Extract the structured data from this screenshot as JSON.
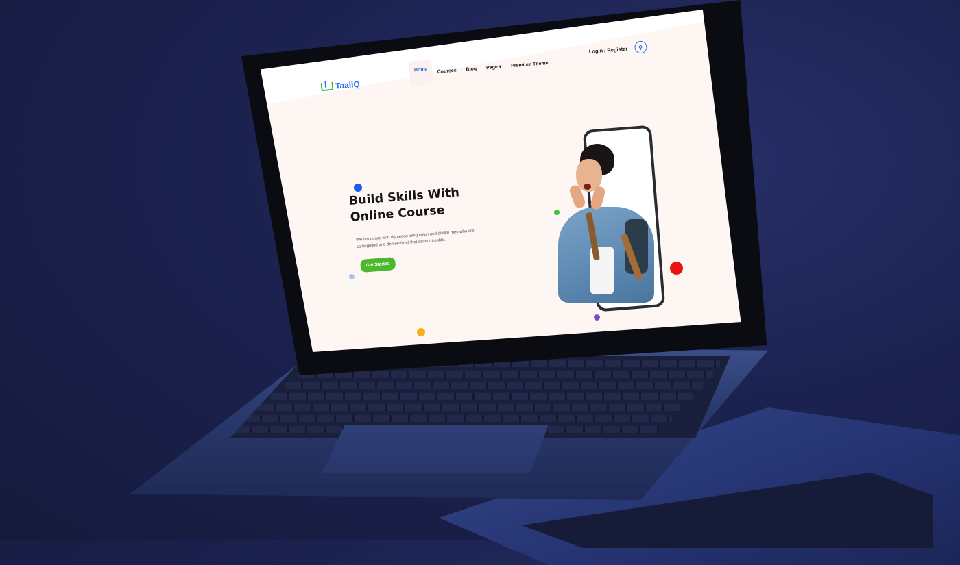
{
  "site": {
    "logo_text": "TaallQ",
    "nav": [
      "Home",
      "Courses",
      "Blog",
      "Page",
      "Premium Theme"
    ],
    "active_nav": "Home",
    "auth_link": "Login / Register"
  },
  "hero": {
    "title_line1": "Build Skills With",
    "title_line2": "Online Course",
    "description": "We denounce with righteous indignation and dislike men who are so beguiled and demoralized that cannot trouble.",
    "cta_label": "Get Started"
  },
  "colors": {
    "accent_blue": "#2a6fe8",
    "cta_green": "#4cb82e",
    "page_bg": "#fdf6f3",
    "dot_blue": "#1a5cf0",
    "dot_green": "#3cc33c",
    "dot_red": "#e8150f",
    "dot_purple": "#7b4cc0",
    "dot_yellow": "#f2b01c",
    "dot_light_blue": "#a7c3f0"
  },
  "icons": {
    "search": "search-icon",
    "dropdown": "chevron-down-icon"
  }
}
